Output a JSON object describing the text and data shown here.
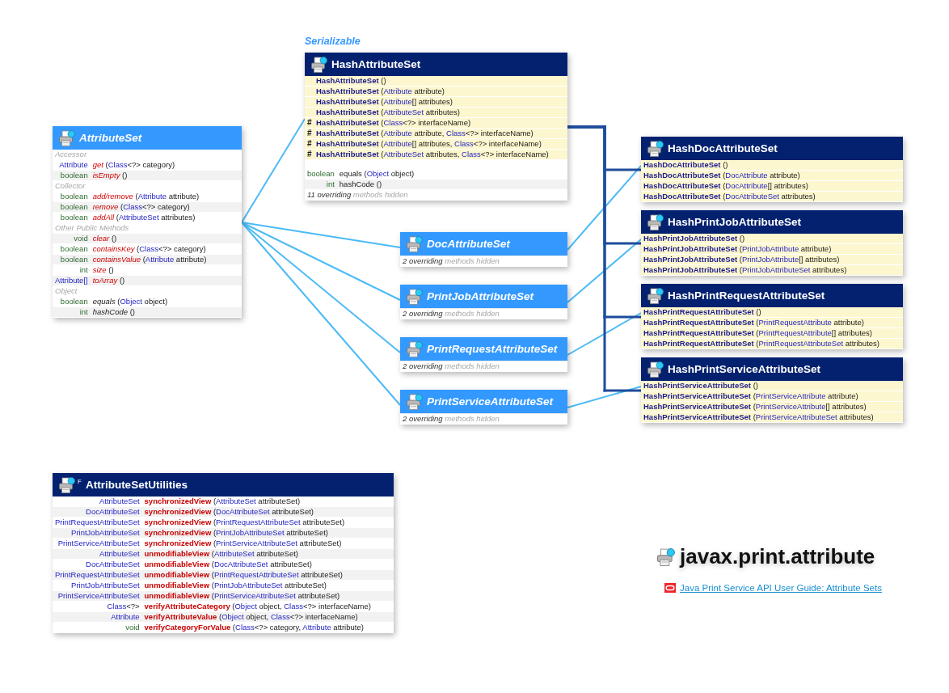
{
  "diagram": {
    "classes": [
      {
        "name": "AttributeSet",
        "kind": "interface",
        "members": [
          {
            "kind": "section",
            "text": "Accessor"
          },
          {
            "kind": "abstract",
            "type": "Attribute",
            "type_primitive": false,
            "name": "get",
            "params": [
              "(",
              "Class",
              "<?> category)"
            ]
          },
          {
            "kind": "abstract",
            "type": "boolean",
            "type_primitive": true,
            "name": "isEmpty",
            "params": [
              "()"
            ]
          },
          {
            "kind": "section",
            "text": "Collector"
          },
          {
            "kind": "abstract",
            "type": "boolean",
            "type_primitive": true,
            "name": "add/remove",
            "params": [
              "(",
              "Attribute",
              " attribute)"
            ]
          },
          {
            "kind": "abstract",
            "type": "boolean",
            "type_primitive": true,
            "name": "remove",
            "params": [
              "(",
              "Class",
              "<?> category)"
            ]
          },
          {
            "kind": "abstract",
            "type": "boolean",
            "type_primitive": true,
            "name": "addAll",
            "params": [
              "(",
              "AttributeSet",
              " attributes)"
            ]
          },
          {
            "kind": "section",
            "text": "Other Public Methods"
          },
          {
            "kind": "abstract",
            "type": "void",
            "type_primitive": true,
            "name": "clear",
            "params": [
              "()"
            ]
          },
          {
            "kind": "abstract",
            "type": "boolean",
            "type_primitive": true,
            "name": "containsKey",
            "params": [
              "(",
              "Class",
              "<?> category)"
            ]
          },
          {
            "kind": "abstract",
            "type": "boolean",
            "type_primitive": true,
            "name": "containsValue",
            "params": [
              "(",
              "Attribute",
              " attribute)"
            ]
          },
          {
            "kind": "abstract",
            "type": "int",
            "type_primitive": true,
            "name": "size",
            "params": [
              "()"
            ]
          },
          {
            "kind": "abstract",
            "type": "Attribute[]",
            "type_primitive": false,
            "name": "toArray",
            "params": [
              "()"
            ]
          },
          {
            "kind": "section",
            "text": "Object"
          },
          {
            "kind": "redeclared",
            "type": "boolean",
            "type_primitive": true,
            "name": "equals",
            "params": [
              "(",
              "Object",
              " object)"
            ]
          },
          {
            "kind": "redeclared",
            "type": "int",
            "type_primitive": true,
            "name": "hashCode",
            "params": [
              "()"
            ]
          }
        ]
      },
      {
        "name": "HashAttributeSet",
        "kind": "class",
        "interfaces": [
          "Serializable"
        ],
        "members": [
          {
            "kind": "constructor",
            "name": "HashAttributeSet",
            "params": [
              "()"
            ]
          },
          {
            "kind": "constructor",
            "name": "HashAttributeSet",
            "params": [
              "(",
              "Attribute",
              " attribute)"
            ]
          },
          {
            "kind": "constructor",
            "name": "HashAttributeSet",
            "params": [
              "(",
              "Attribute",
              "[] attributes)"
            ]
          },
          {
            "kind": "constructor",
            "name": "HashAttributeSet",
            "params": [
              "(",
              "AttributeSet",
              " attributes)"
            ]
          },
          {
            "kind": "constructor",
            "modifier": "#",
            "name": "HashAttributeSet",
            "params": [
              "(",
              "Class",
              "<?> interfaceName)"
            ]
          },
          {
            "kind": "constructor",
            "modifier": "#",
            "name": "HashAttributeSet",
            "params": [
              "(",
              "Attribute",
              " attribute, ",
              "Class",
              "<?> interfaceName)"
            ]
          },
          {
            "kind": "constructor",
            "modifier": "#",
            "name": "HashAttributeSet",
            "params": [
              "(",
              "Attribute",
              "[] attributes, ",
              "Class",
              "<?> interfaceName)"
            ]
          },
          {
            "kind": "constructor",
            "modifier": "#",
            "name": "HashAttributeSet",
            "params": [
              "(",
              "AttributeSet",
              " attributes, ",
              "Class",
              "<?> interfaceName)"
            ]
          },
          {
            "kind": "method",
            "type": "boolean",
            "type_primitive": true,
            "name": "equals",
            "params": [
              "(",
              "Object",
              " object)"
            ]
          },
          {
            "kind": "method",
            "type": "int",
            "type_primitive": true,
            "name": "hashCode",
            "params": [
              "()"
            ]
          }
        ],
        "hidden_note": {
          "count": "11 overriding",
          "text": "methods hidden"
        }
      },
      {
        "name": "DocAttributeSet",
        "kind": "interface",
        "hidden_note": {
          "count": "2 overriding",
          "text": "methods hidden"
        }
      },
      {
        "name": "PrintJobAttributeSet",
        "kind": "interface",
        "hidden_note": {
          "count": "2 overriding",
          "text": "methods hidden"
        }
      },
      {
        "name": "PrintRequestAttributeSet",
        "kind": "interface",
        "hidden_note": {
          "count": "2 overriding",
          "text": "methods hidden"
        }
      },
      {
        "name": "PrintServiceAttributeSet",
        "kind": "interface",
        "hidden_note": {
          "count": "2 overriding",
          "text": "methods hidden"
        }
      },
      {
        "name": "HashDocAttributeSet",
        "kind": "class",
        "members": [
          {
            "kind": "constructor",
            "name": "HashDocAttributeSet",
            "params": [
              "()"
            ]
          },
          {
            "kind": "constructor",
            "name": "HashDocAttributeSet",
            "params": [
              "(",
              "DocAttribute",
              " attribute)"
            ]
          },
          {
            "kind": "constructor",
            "name": "HashDocAttributeSet",
            "params": [
              "(",
              "DocAttribute",
              "[] attributes)"
            ]
          },
          {
            "kind": "constructor",
            "name": "HashDocAttributeSet",
            "params": [
              "(",
              "DocAttributeSet",
              " attributes)"
            ]
          }
        ]
      },
      {
        "name": "HashPrintJobAttributeSet",
        "kind": "class",
        "members": [
          {
            "kind": "constructor",
            "name": "HashPrintJobAttributeSet",
            "params": [
              "()"
            ]
          },
          {
            "kind": "constructor",
            "name": "HashPrintJobAttributeSet",
            "params": [
              "(",
              "PrintJobAttribute",
              " attribute)"
            ]
          },
          {
            "kind": "constructor",
            "name": "HashPrintJobAttributeSet",
            "params": [
              "(",
              "PrintJobAttribute",
              "[] attributes)"
            ]
          },
          {
            "kind": "constructor",
            "name": "HashPrintJobAttributeSet",
            "params": [
              "(",
              "PrintJobAttributeSet",
              " attributes)"
            ]
          }
        ]
      },
      {
        "name": "HashPrintRequestAttributeSet",
        "kind": "class",
        "members": [
          {
            "kind": "constructor",
            "name": "HashPrintRequestAttributeSet",
            "params": [
              "()"
            ]
          },
          {
            "kind": "constructor",
            "name": "HashPrintRequestAttributeSet",
            "params": [
              "(",
              "PrintRequestAttribute",
              " attribute)"
            ]
          },
          {
            "kind": "constructor",
            "name": "HashPrintRequestAttributeSet",
            "params": [
              "(",
              "PrintRequestAttribute",
              "[] attributes)"
            ]
          },
          {
            "kind": "constructor",
            "name": "HashPrintRequestAttributeSet",
            "params": [
              "(",
              "PrintRequestAttributeSet",
              " attributes)"
            ]
          }
        ]
      },
      {
        "name": "HashPrintServiceAttributeSet",
        "kind": "class",
        "members": [
          {
            "kind": "constructor",
            "name": "HashPrintServiceAttributeSet",
            "params": [
              "()"
            ]
          },
          {
            "kind": "constructor",
            "name": "HashPrintServiceAttributeSet",
            "params": [
              "(",
              "PrintServiceAttribute",
              " attribute)"
            ]
          },
          {
            "kind": "constructor",
            "name": "HashPrintServiceAttributeSet",
            "params": [
              "(",
              "PrintServiceAttribute",
              "[] attributes)"
            ]
          },
          {
            "kind": "constructor",
            "name": "HashPrintServiceAttributeSet",
            "params": [
              "(",
              "PrintServiceAttributeSet",
              " attributes)"
            ]
          }
        ]
      },
      {
        "name": "AttributeSetUtilities",
        "kind": "class",
        "modifier": "F",
        "members": [
          {
            "kind": "static",
            "type": "AttributeSet",
            "type_primitive": false,
            "name": "synchronizedView",
            "params": [
              "(",
              "AttributeSet",
              " attributeSet)"
            ]
          },
          {
            "kind": "static",
            "type": "DocAttributeSet",
            "type_primitive": false,
            "name": "synchronizedView",
            "params": [
              "(",
              "DocAttributeSet",
              " attributeSet)"
            ]
          },
          {
            "kind": "static",
            "type": "PrintRequestAttributeSet",
            "type_primitive": false,
            "name": "synchronizedView",
            "params": [
              "(",
              "PrintRequestAttributeSet",
              " attributeSet)"
            ]
          },
          {
            "kind": "static",
            "type": "PrintJobAttributeSet",
            "type_primitive": false,
            "name": "synchronizedView",
            "params": [
              "(",
              "PrintJobAttributeSet",
              " attributeSet)"
            ]
          },
          {
            "kind": "static",
            "type": "PrintServiceAttributeSet",
            "type_primitive": false,
            "name": "synchronizedView",
            "params": [
              "(",
              "PrintServiceAttributeSet",
              " attributeSet)"
            ]
          },
          {
            "kind": "static",
            "type": "AttributeSet",
            "type_primitive": false,
            "name": "unmodifiableView",
            "params": [
              "(",
              "AttributeSet",
              " attributeSet)"
            ]
          },
          {
            "kind": "static",
            "type": "DocAttributeSet",
            "type_primitive": false,
            "name": "unmodifiableView",
            "params": [
              "(",
              "DocAttributeSet",
              " attributeSet)"
            ]
          },
          {
            "kind": "static",
            "type": "PrintRequestAttributeSet",
            "type_primitive": false,
            "name": "unmodifiableView",
            "params": [
              "(",
              "PrintRequestAttributeSet",
              " attributeSet)"
            ]
          },
          {
            "kind": "static",
            "type": "PrintJobAttributeSet",
            "type_primitive": false,
            "name": "unmodifiableView",
            "params": [
              "(",
              "PrintJobAttributeSet",
              " attributeSet)"
            ]
          },
          {
            "kind": "static",
            "type": "PrintServiceAttributeSet",
            "type_primitive": false,
            "name": "unmodifiableView",
            "params": [
              "(",
              "PrintServiceAttributeSet",
              " attributeSet)"
            ]
          },
          {
            "kind": "static",
            "type": "Class",
            "type_suffix": "<?>",
            "type_primitive": false,
            "name": "verifyAttributeCategory",
            "params": [
              "(",
              "Object",
              " object, ",
              "Class",
              "<?> interfaceName)"
            ]
          },
          {
            "kind": "static",
            "type": "Attribute",
            "type_primitive": false,
            "name": "verifyAttributeValue",
            "params": [
              "(",
              "Object",
              " object, ",
              "Class",
              "<?> interfaceName)"
            ]
          },
          {
            "kind": "static",
            "type": "void",
            "type_primitive": true,
            "name": "verifyCategoryForValue",
            "params": [
              "(",
              "Class",
              "<?> category, ",
              "Attribute",
              " attribute)"
            ]
          }
        ]
      }
    ]
  },
  "package": {
    "title": "javax.print.attribute",
    "link": "Java Print Service API User Guide: Attribute Sets"
  }
}
